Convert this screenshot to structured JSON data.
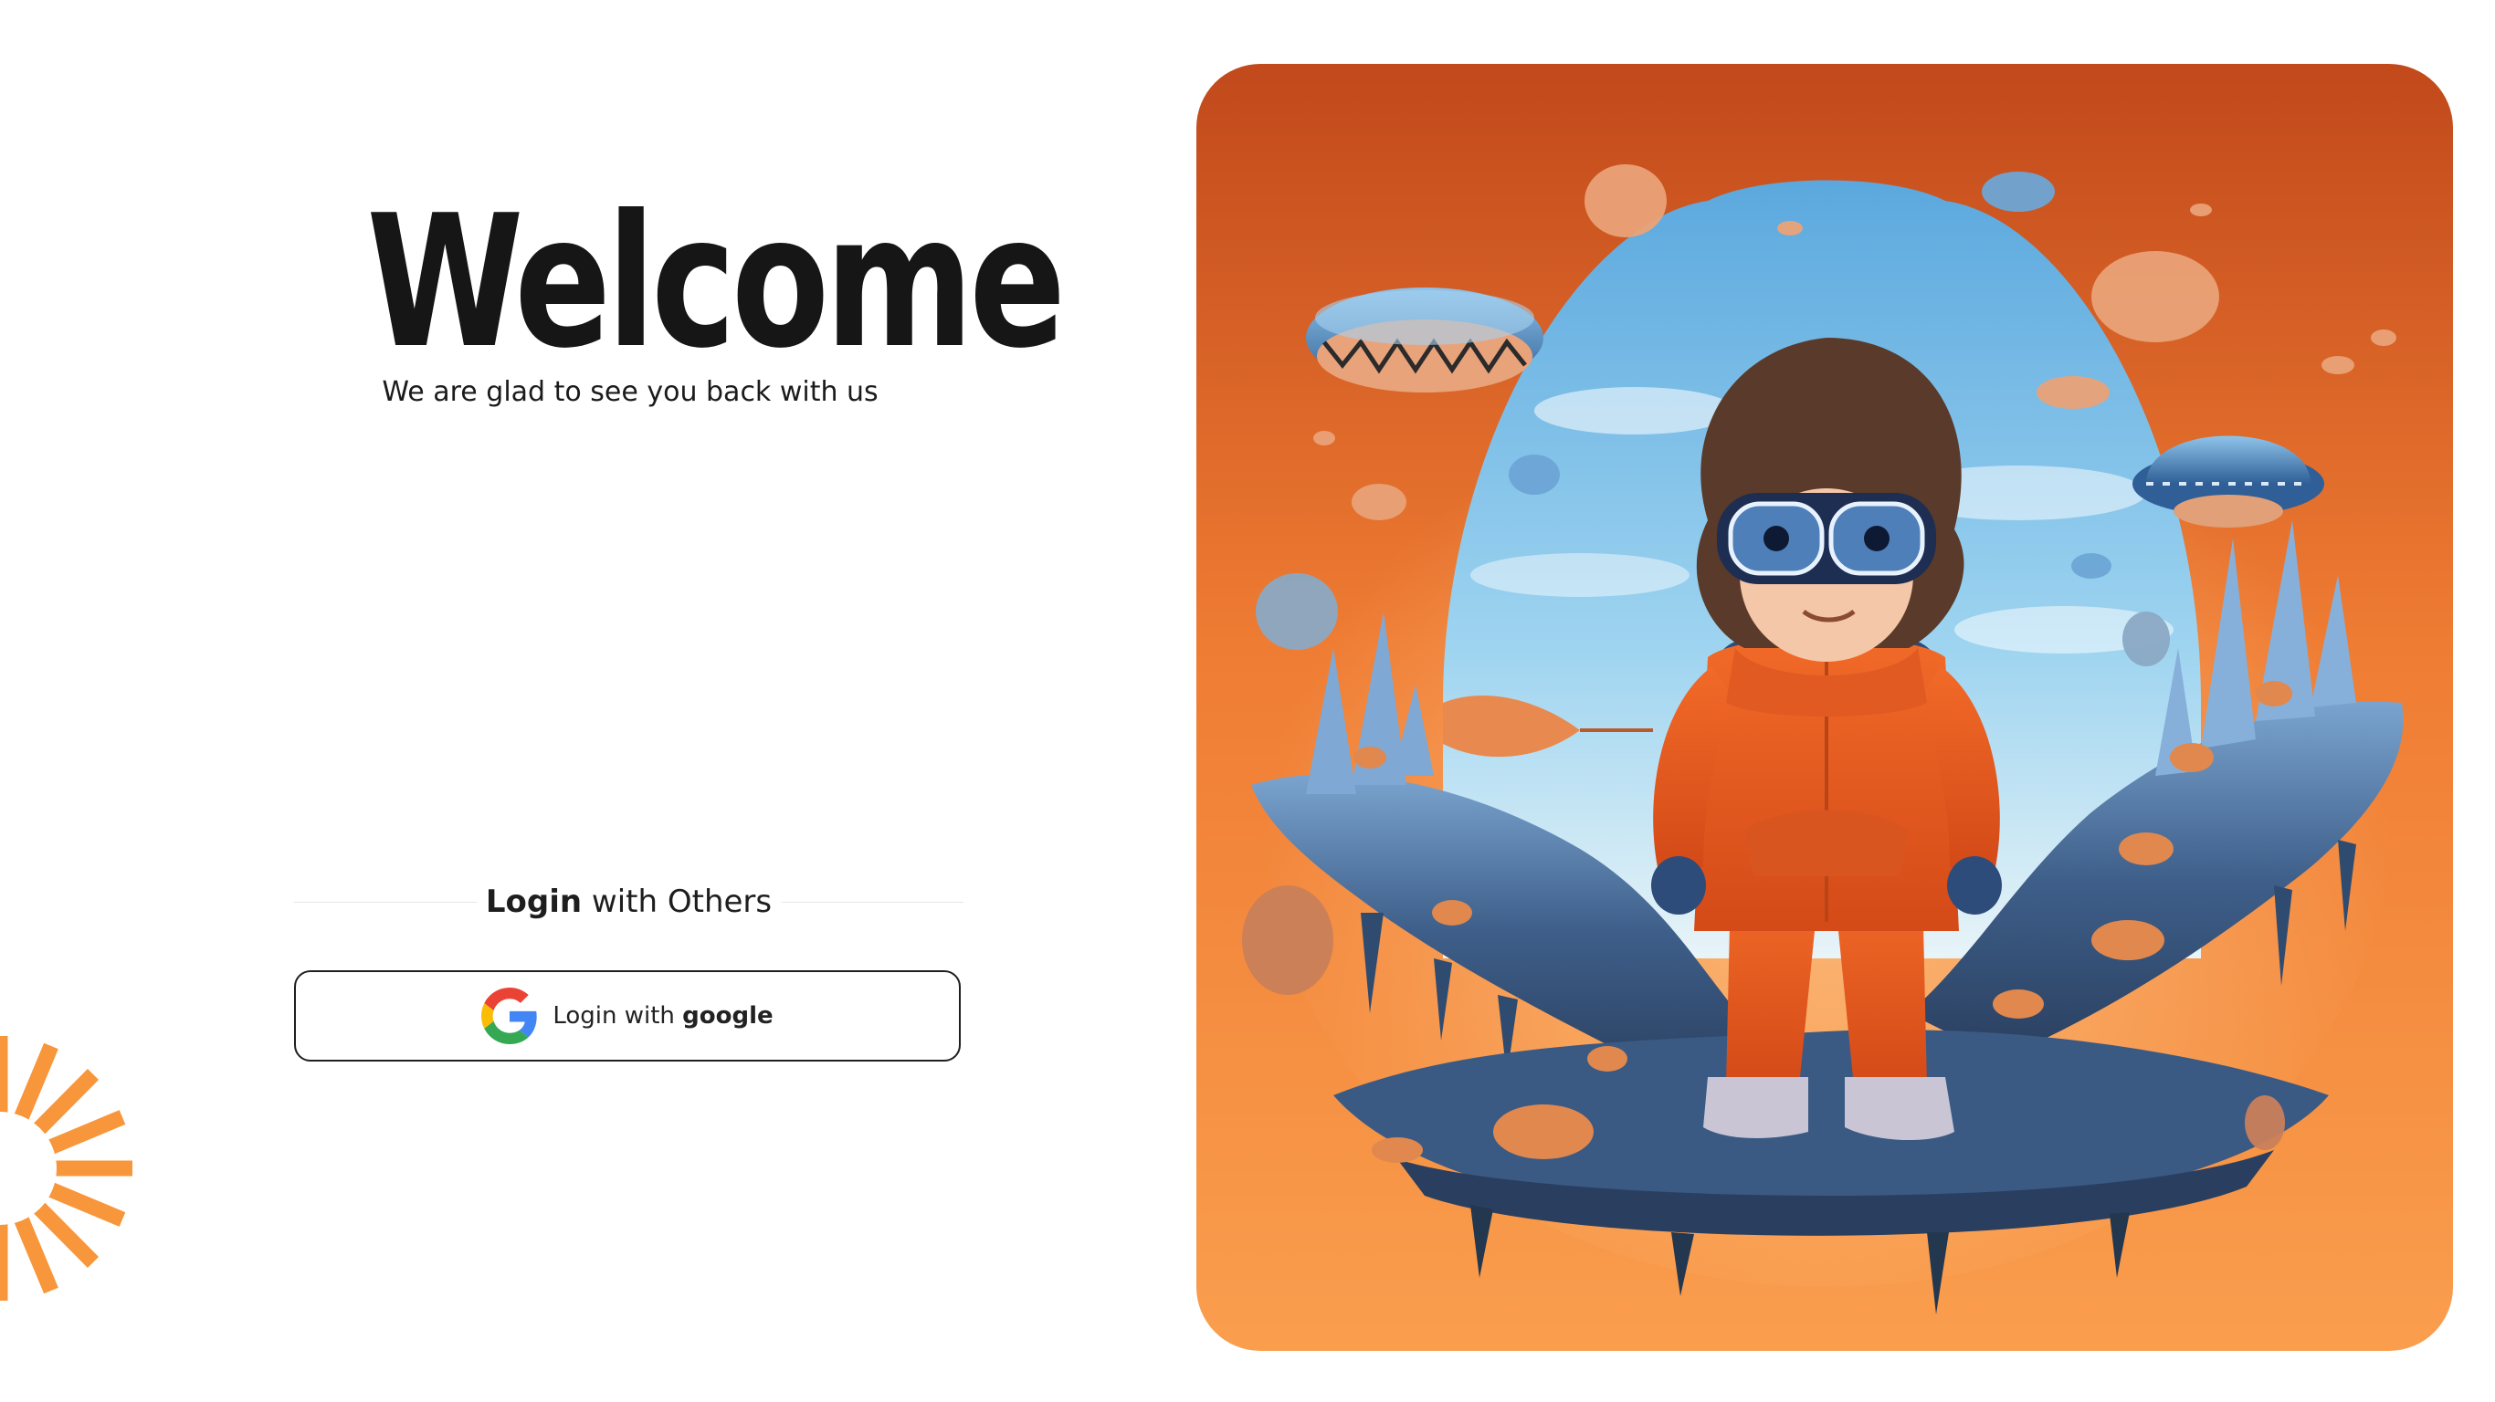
{
  "welcome": {
    "title": "Welcome",
    "subtitle": "We are glad to see you back with us"
  },
  "divider": {
    "label_bold": "Login",
    "label_rest": " with Others"
  },
  "google_button": {
    "label_prefix": "Login with ",
    "label_bold": "google",
    "icon": "google-g-icon"
  },
  "decor": {
    "burst_icon": "sunburst-icon",
    "hero_illustration": "vr-kid-illustration"
  },
  "colors": {
    "accent": "#f7963a",
    "hero_bg_top": "#c44e1d",
    "hero_bg_bottom": "#f99d4c",
    "sky": "#7ec4ea",
    "rock": "#3f5e86",
    "suit": "#ee5a1f"
  }
}
